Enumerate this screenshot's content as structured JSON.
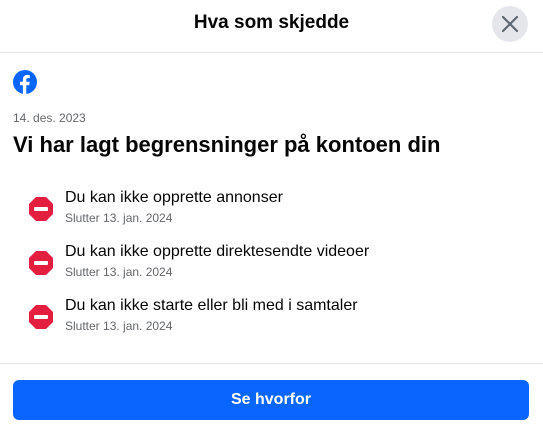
{
  "dialog": {
    "title": "Hva som skjedde",
    "close_icon": "close-icon"
  },
  "content": {
    "logo_icon": "facebook-logo-icon",
    "date": "14. des. 2023",
    "headline": "Vi har lagt begrensninger på kontoen din",
    "restrictions": [
      {
        "title": "Du kan ikke opprette annonser",
        "ends": "Slutter 13. jan. 2024",
        "icon": "stop-icon"
      },
      {
        "title": "Du kan ikke opprette direktesendte videoer",
        "ends": "Slutter 13. jan. 2024",
        "icon": "stop-icon"
      },
      {
        "title": "Du kan ikke starte eller bli med i samtaler",
        "ends": "Slutter 13. jan. 2024",
        "icon": "stop-icon"
      }
    ]
  },
  "footer": {
    "primary_label": "Se hvorfor"
  },
  "colors": {
    "brand_blue": "#0866ff",
    "stop_red": "#e41e3f",
    "secondary_text": "#65676b"
  }
}
